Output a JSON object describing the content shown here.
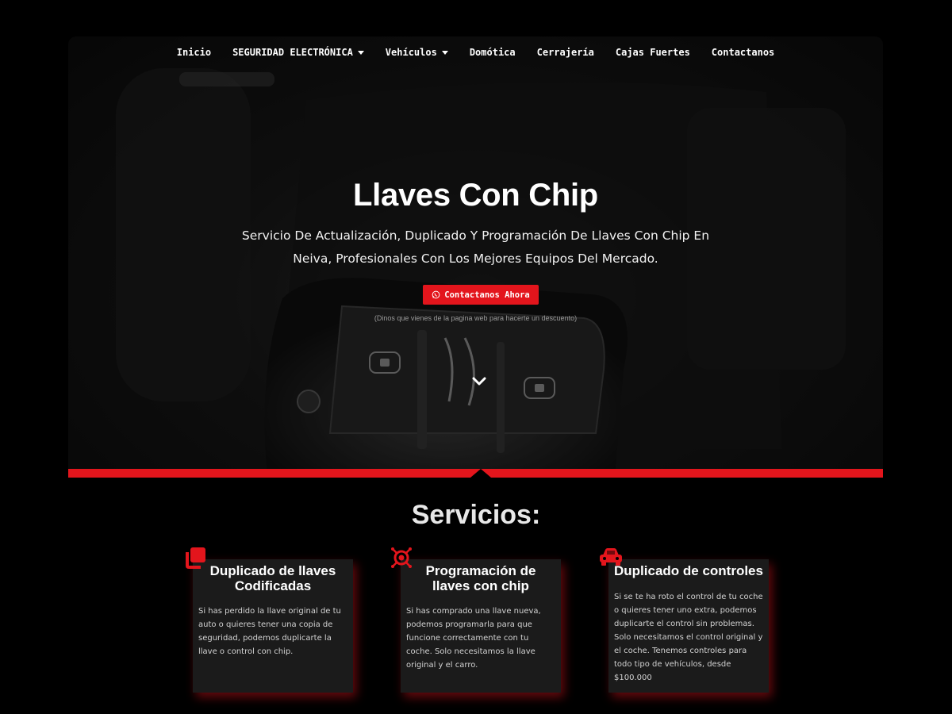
{
  "nav": {
    "items": [
      {
        "label": "Inicio",
        "dropdown": false
      },
      {
        "label": "SEGURIDAD ELECTRÓNICA",
        "dropdown": true
      },
      {
        "label": "Vehículos",
        "dropdown": true
      },
      {
        "label": "Domótica",
        "dropdown": false
      },
      {
        "label": "Cerrajería",
        "dropdown": false
      },
      {
        "label": "Cajas Fuertes",
        "dropdown": false
      },
      {
        "label": "Contactanos",
        "dropdown": false
      }
    ]
  },
  "hero": {
    "title": "Llaves Con Chip",
    "subtitle": "Servicio De Actualización, Duplicado Y Programación De Llaves Con Chip En Neiva, Profesionales Con Los Mejores Equipos Del Mercado.",
    "cta_label": "Contactanos Ahora",
    "cta_icon": "whatsapp-icon",
    "note": "(Dinos que vienes de la pagina web para hacerte un descuento)",
    "scroll_icon": "chevron-down-icon"
  },
  "services": {
    "title": "Servicios:",
    "cards": [
      {
        "title": "Duplicado de llaves Codificadas",
        "text": "Si has perdido la llave original de tu auto o quieres tener una copia de seguridad, podemos duplicarte la llave o control con chip.",
        "icon": "copy-icon"
      },
      {
        "title": "Programación de llaves con chip",
        "text": "Si has comprado una llave nueva, podemos programarla para que funcione correctamente con tu coche. Solo necesitamos la llave original y el carro.",
        "icon": "chip-icon"
      },
      {
        "title": "Duplicado de controles",
        "text": "Si se te ha roto el control de tu coche o quieres tener uno extra, podemos duplicarte el control sin problemas. Solo necesitamos el control original y el coche. Tenemos controles para todo tipo de vehículos, desde $100.000",
        "icon": "car-icon"
      }
    ]
  },
  "colors": {
    "accent": "#e3151c",
    "background": "#000000",
    "card": "#1b1b1b"
  }
}
